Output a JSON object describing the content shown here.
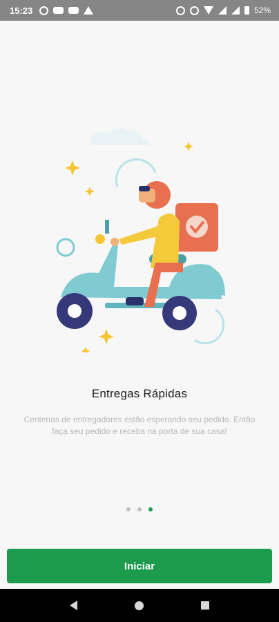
{
  "status_bar": {
    "time": "15:23",
    "battery": "52%",
    "icons_left": [
      "pinterest-icon",
      "youtube-icon",
      "link-icon",
      "warning-icon"
    ],
    "icons_right": [
      "alarm-icon",
      "mute-icon",
      "wifi-icon",
      "signal-icon",
      "signal-alt-icon",
      "battery-icon"
    ]
  },
  "onboarding": {
    "illustration": "delivery-scooter-illustration",
    "title": "Entregas Rápidas",
    "description": "Centenas de entregadores estão esperando seu pedido. Então faça seu pedido e receba na porta de sua casa!",
    "page_count": 3,
    "active_page": 3
  },
  "actions": {
    "start_label": "Iniciar"
  },
  "colors": {
    "accent": "#1c9b4d",
    "rider_orange": "#e86f4f",
    "scooter_teal": "#7fcbd1",
    "sparkle": "#f6c533"
  },
  "nav_bar": {
    "buttons": [
      "back",
      "home",
      "recents"
    ]
  }
}
